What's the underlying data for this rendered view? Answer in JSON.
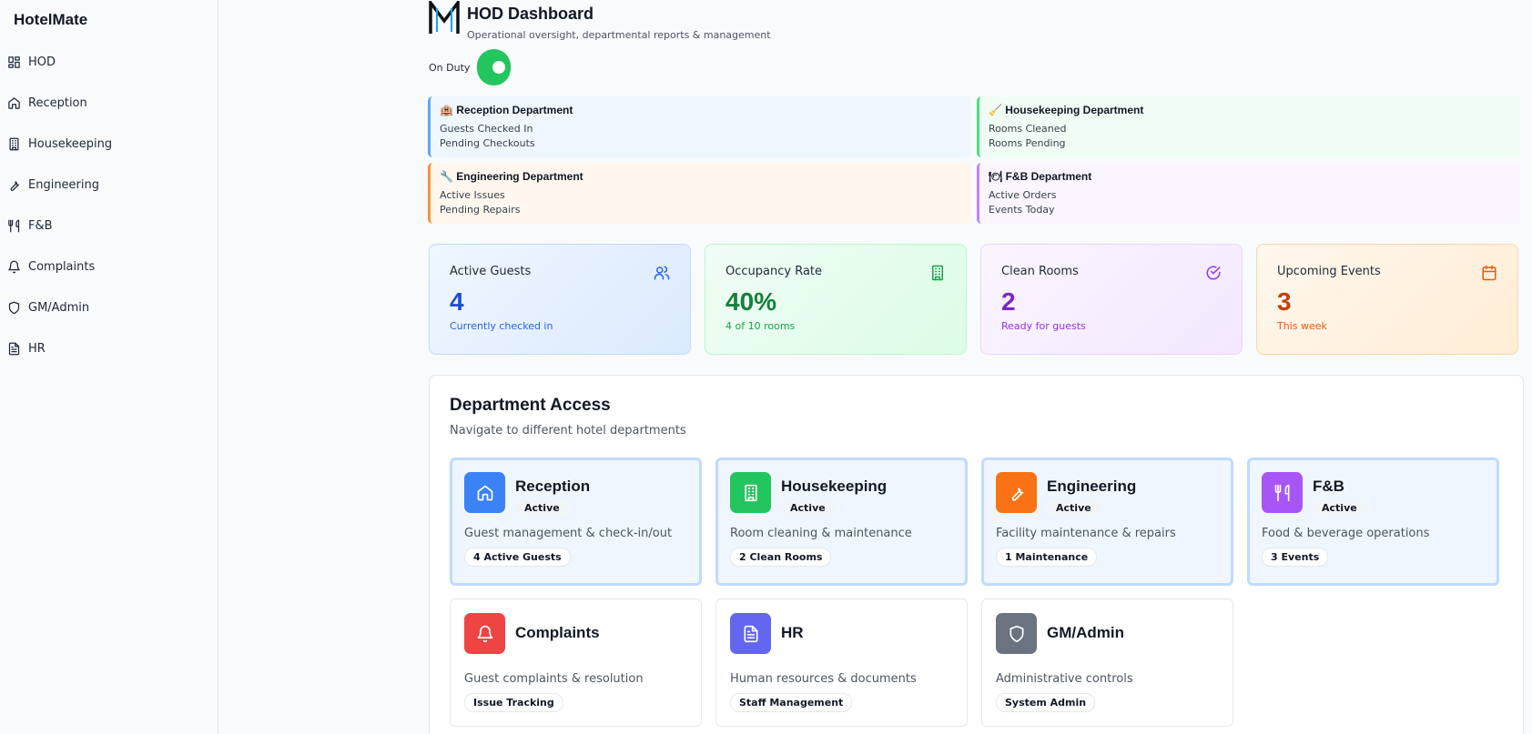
{
  "sidebar": {
    "brand": "HotelMate",
    "items": [
      {
        "label": "HOD",
        "icon": "grid-icon"
      },
      {
        "label": "Reception",
        "icon": "home-icon"
      },
      {
        "label": "Housekeeping",
        "icon": "building-icon"
      },
      {
        "label": "Engineering",
        "icon": "wrench-icon"
      },
      {
        "label": "F&B",
        "icon": "utensils-icon"
      },
      {
        "label": "Complaints",
        "icon": "bell-icon"
      },
      {
        "label": "GM/Admin",
        "icon": "shield-icon"
      },
      {
        "label": "HR",
        "icon": "file-icon"
      }
    ]
  },
  "header": {
    "title": "HOD Dashboard",
    "subtitle": "Operational oversight, departmental reports & management",
    "logo": "M"
  },
  "duty": {
    "label": "On Duty",
    "on": true
  },
  "dept_summary": [
    {
      "icon": "🏨",
      "title": "Reception Department",
      "lines": [
        "Guests Checked In",
        "Pending Checkouts"
      ]
    },
    {
      "icon": "🧹",
      "title": "Housekeeping Department",
      "lines": [
        "Rooms Cleaned",
        "Rooms Pending"
      ]
    },
    {
      "icon": "🔧",
      "title": "Engineering Department",
      "lines": [
        "Active Issues",
        "Pending Repairs"
      ]
    },
    {
      "icon": "🍽",
      "title": "F&B Department",
      "lines": [
        "Active Orders",
        "Events Today"
      ]
    }
  ],
  "stats": [
    {
      "label": "Active Guests",
      "value": "4",
      "note": "Currently checked in",
      "color": "#1d4ed8",
      "icon": "users-icon"
    },
    {
      "label": "Occupancy Rate",
      "value": "40%",
      "note": "4 of 10 rooms",
      "color": "#15803d",
      "icon": "building-icon"
    },
    {
      "label": "Clean Rooms",
      "value": "2",
      "note": "Ready for guests",
      "color": "#7e22ce",
      "icon": "check-circle-icon"
    },
    {
      "label": "Upcoming Events",
      "value": "3",
      "note": "This week",
      "color": "#c2410c",
      "icon": "calendar-icon"
    }
  ],
  "access": {
    "title": "Department Access",
    "subtitle": "Navigate to different hotel departments",
    "cards": [
      {
        "name": "Reception",
        "badge": "Active",
        "desc": "Guest management & check-in/out",
        "tag": "4 Active Guests",
        "color": "#3b82f6",
        "icon": "home-icon"
      },
      {
        "name": "Housekeeping",
        "badge": "Active",
        "desc": "Room cleaning & maintenance",
        "tag": "2 Clean Rooms",
        "color": "#22c55e",
        "icon": "building-icon"
      },
      {
        "name": "Engineering",
        "badge": "Active",
        "desc": "Facility maintenance & repairs",
        "tag": "1 Maintenance",
        "color": "#f97316",
        "icon": "wrench-icon"
      },
      {
        "name": "F&B",
        "badge": "Active",
        "desc": "Food & beverage operations",
        "tag": "3 Events",
        "color": "#a855f7",
        "icon": "utensils-icon"
      },
      {
        "name": "Complaints",
        "badge": "",
        "desc": "Guest complaints & resolution",
        "tag": "Issue Tracking",
        "color": "#ef4444",
        "icon": "bell-icon"
      },
      {
        "name": "HR",
        "badge": "",
        "desc": "Human resources & documents",
        "tag": "Staff Management",
        "color": "#6366f1",
        "icon": "file-icon"
      },
      {
        "name": "GM/Admin",
        "badge": "",
        "desc": "Administrative controls",
        "tag": "System Admin",
        "color": "#6b7280",
        "icon": "shield-icon"
      }
    ]
  }
}
